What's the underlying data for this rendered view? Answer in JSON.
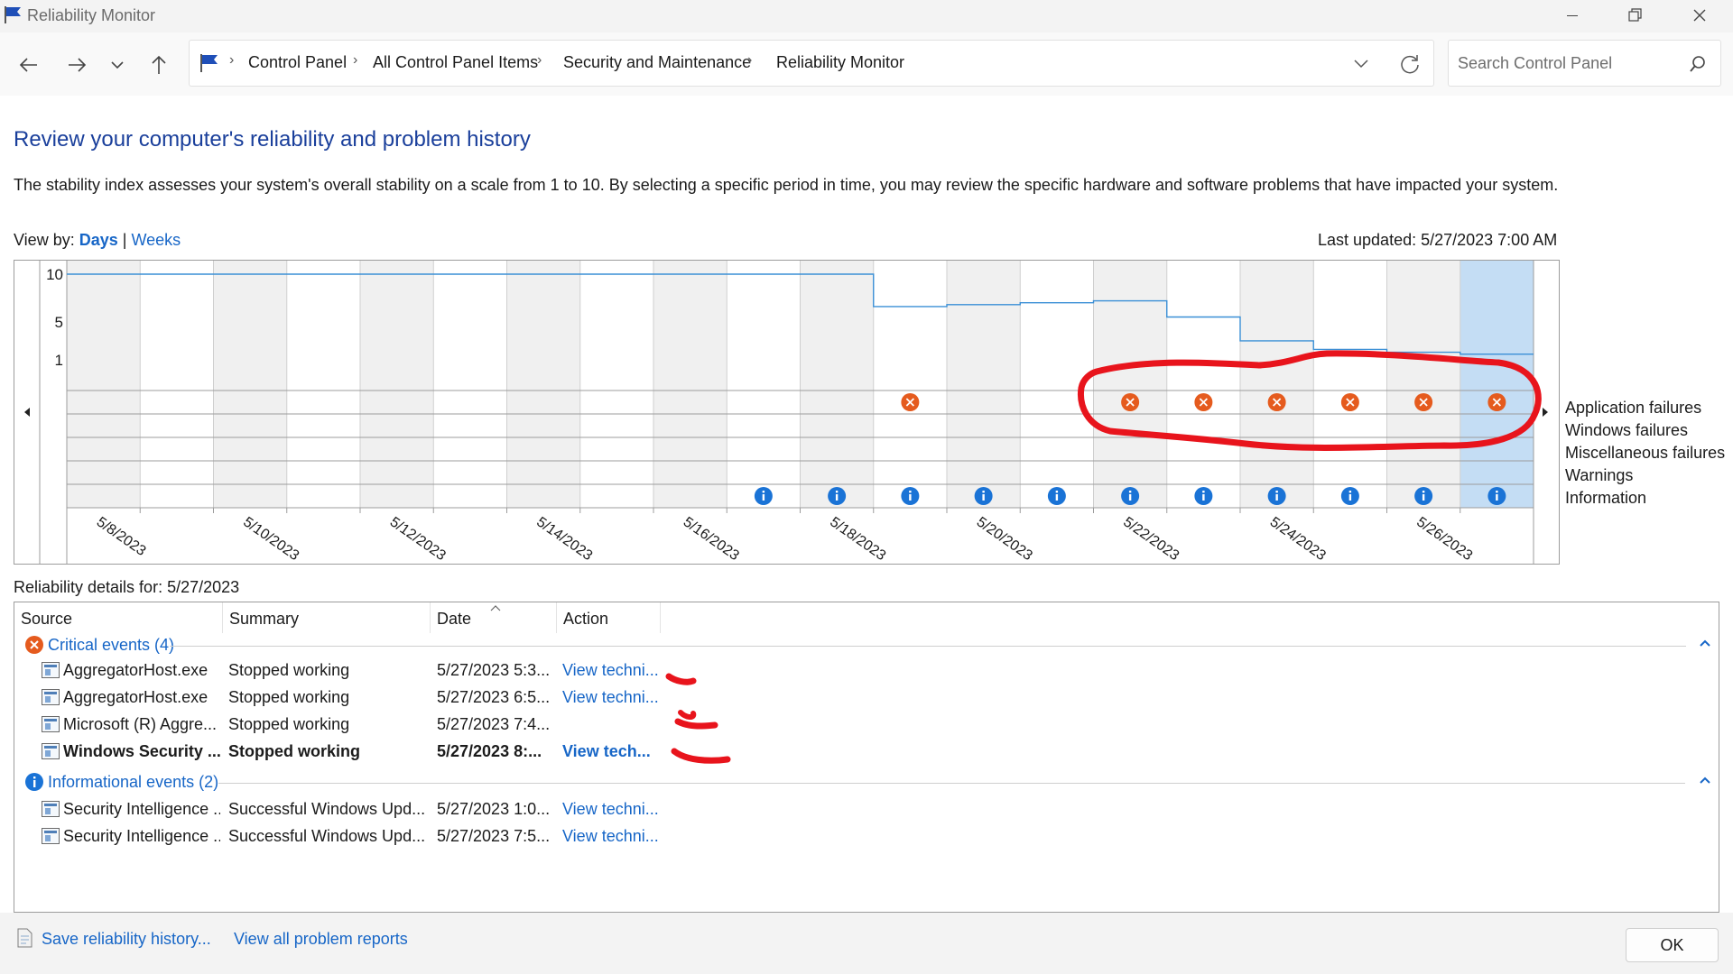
{
  "window": {
    "title": "Reliability Monitor"
  },
  "breadcrumb": [
    "Control Panel",
    "All Control Panel Items",
    "Security and Maintenance",
    "Reliability Monitor"
  ],
  "search": {
    "placeholder": "Search Control Panel"
  },
  "heading": "Review your computer's reliability and problem history",
  "description": "The stability index assesses your system's overall stability on a scale from 1 to 10. By selecting a specific period in time, you may review the specific hardware and software problems that have impacted your system.",
  "view_by": {
    "label": "View by:",
    "days": "Days",
    "sep": "|",
    "weeks": "Weeks"
  },
  "last_updated": "Last updated: 5/27/2023 7:00 AM",
  "chart": {
    "y_ticks": [
      "10",
      "5",
      "1"
    ],
    "date_labels": [
      "5/8/2023",
      "5/10/2023",
      "5/12/2023",
      "5/14/2023",
      "5/16/2023",
      "5/18/2023",
      "5/20/2023",
      "5/22/2023",
      "5/24/2023",
      "5/26/2023"
    ],
    "legend": [
      "Application failures",
      "Windows failures",
      "Miscellaneous failures",
      "Warnings",
      "Information"
    ],
    "colors": {
      "stability_line": "#3a8fd6",
      "selected_column": "#c4ddf4",
      "shaded_column": "#f0f0f0",
      "error_icon": "#e55b1e",
      "info_icon": "#1a73d6",
      "annotation": "#e8141c"
    }
  },
  "chart_data": {
    "type": "line",
    "y_range": [
      1,
      10
    ],
    "x": [
      "5/8/2023",
      "5/9/2023",
      "5/10/2023",
      "5/11/2023",
      "5/12/2023",
      "5/13/2023",
      "5/14/2023",
      "5/15/2023",
      "5/16/2023",
      "5/17/2023",
      "5/18/2023",
      "5/19/2023",
      "5/20/2023",
      "5/21/2023",
      "5/22/2023",
      "5/23/2023",
      "5/24/2023",
      "5/25/2023",
      "5/26/2023",
      "5/27/2023"
    ],
    "stability_index": [
      10,
      10,
      10,
      10,
      10,
      10,
      10,
      10,
      10,
      10,
      10,
      6.6,
      6.8,
      7.0,
      7.2,
      5.5,
      3.0,
      2.1,
      1.8,
      1.6
    ],
    "application_failures": [
      0,
      0,
      0,
      0,
      0,
      0,
      0,
      0,
      0,
      0,
      0,
      1,
      0,
      0,
      1,
      1,
      1,
      1,
      1,
      1
    ],
    "information": [
      0,
      0,
      0,
      0,
      0,
      0,
      0,
      0,
      0,
      1,
      1,
      1,
      1,
      1,
      1,
      1,
      1,
      1,
      1,
      1
    ],
    "selected": "5/27/2023"
  },
  "details": {
    "label": "Reliability details for: 5/27/2023",
    "columns": [
      "Source",
      "Summary",
      "Date",
      "Action"
    ],
    "groups": [
      {
        "title": "Critical events (4)",
        "rows": [
          {
            "source": "AggregatorHost.exe",
            "summary": "Stopped working",
            "date": "5/27/2023 5:3...",
            "action": "View techni..."
          },
          {
            "source": "AggregatorHost.exe",
            "summary": "Stopped working",
            "date": "5/27/2023 6:5...",
            "action": "View techni..."
          },
          {
            "source": "Microsoft (R) Aggre...",
            "summary": "Stopped working",
            "date": "5/27/2023 7:4...",
            "action": ""
          },
          {
            "source": "Windows Security ...",
            "summary": "Stopped working",
            "date": "5/27/2023 8:...",
            "action": "View tech..."
          }
        ]
      },
      {
        "title": "Informational events (2)",
        "rows": [
          {
            "source": "Security Intelligence ...",
            "summary": "Successful Windows Upd...",
            "date": "5/27/2023 1:0...",
            "action": "View techni..."
          },
          {
            "source": "Security Intelligence ...",
            "summary": "Successful Windows Upd...",
            "date": "5/27/2023 7:5...",
            "action": "View techni..."
          }
        ]
      }
    ]
  },
  "footer": {
    "save_history": "Save reliability history...",
    "view_all": "View all problem reports",
    "ok": "OK"
  }
}
